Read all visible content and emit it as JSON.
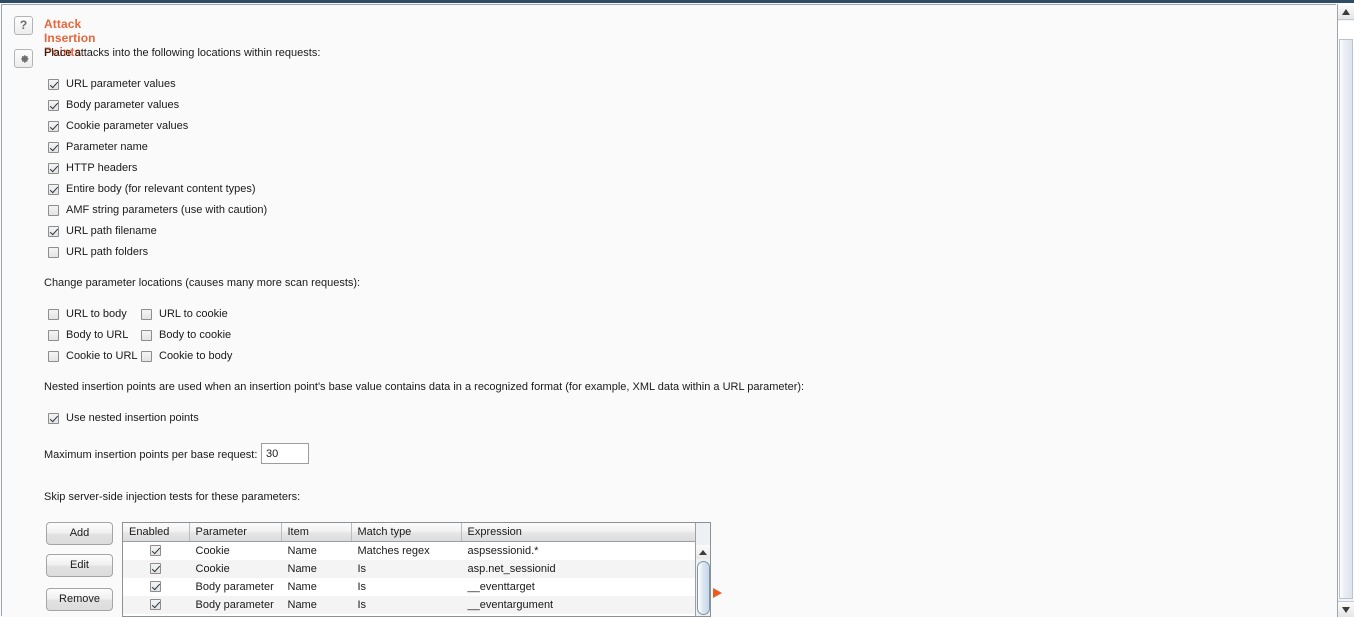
{
  "panel": {
    "title": "Attack Insertion Points",
    "help_icon": "question-mark-icon",
    "config_icon": "gear-icon",
    "accent_color": "#e8663c"
  },
  "intro_text": "Place attacks into the following locations within requests:",
  "insertion_points": [
    {
      "label": "URL parameter values",
      "checked": true
    },
    {
      "label": "Body parameter values",
      "checked": true
    },
    {
      "label": "Cookie parameter values",
      "checked": true
    },
    {
      "label": "Parameter name",
      "checked": true
    },
    {
      "label": "HTTP headers",
      "checked": true
    },
    {
      "label": "Entire body (for relevant content types)",
      "checked": true
    },
    {
      "label": "AMF string parameters (use with caution)",
      "checked": false
    },
    {
      "label": "URL path filename",
      "checked": true
    },
    {
      "label": "URL path folders",
      "checked": false
    }
  ],
  "change_locations": {
    "text": "Change parameter locations (causes many more scan requests):",
    "options": [
      {
        "label": "URL to body",
        "checked": false
      },
      {
        "label": "URL to cookie",
        "checked": false
      },
      {
        "label": "Body to URL",
        "checked": false
      },
      {
        "label": "Body to cookie",
        "checked": false
      },
      {
        "label": "Cookie to URL",
        "checked": false
      },
      {
        "label": "Cookie to body",
        "checked": false
      }
    ]
  },
  "nested": {
    "text": "Nested insertion points are used when an insertion point's base value contains data in a recognized format (for example, XML data within a URL parameter):",
    "option": {
      "label": "Use nested insertion points",
      "checked": true
    }
  },
  "max_insertion": {
    "label": "Maximum insertion points per base request:",
    "value": "30",
    "placeholder": ""
  },
  "skip_section": {
    "text": "Skip server-side injection tests for these parameters:",
    "buttons": [
      {
        "label": "Add"
      },
      {
        "label": "Edit"
      },
      {
        "label": "Remove"
      }
    ],
    "table": {
      "columns": [
        "Enabled",
        "Parameter",
        "Item",
        "Match type",
        "Expression"
      ],
      "rows": [
        {
          "enabled": true,
          "parameter": "Cookie",
          "item": "Name",
          "match_type": "Matches regex",
          "expression": "aspsessionid.*"
        },
        {
          "enabled": true,
          "parameter": "Cookie",
          "item": "Name",
          "match_type": "Is",
          "expression": "asp.net_sessionid"
        },
        {
          "enabled": true,
          "parameter": "Body parameter",
          "item": "Name",
          "match_type": "Is",
          "expression": "__eventtarget"
        },
        {
          "enabled": true,
          "parameter": "Body parameter",
          "item": "Name",
          "match_type": "Is",
          "expression": "__eventargument"
        }
      ]
    }
  }
}
